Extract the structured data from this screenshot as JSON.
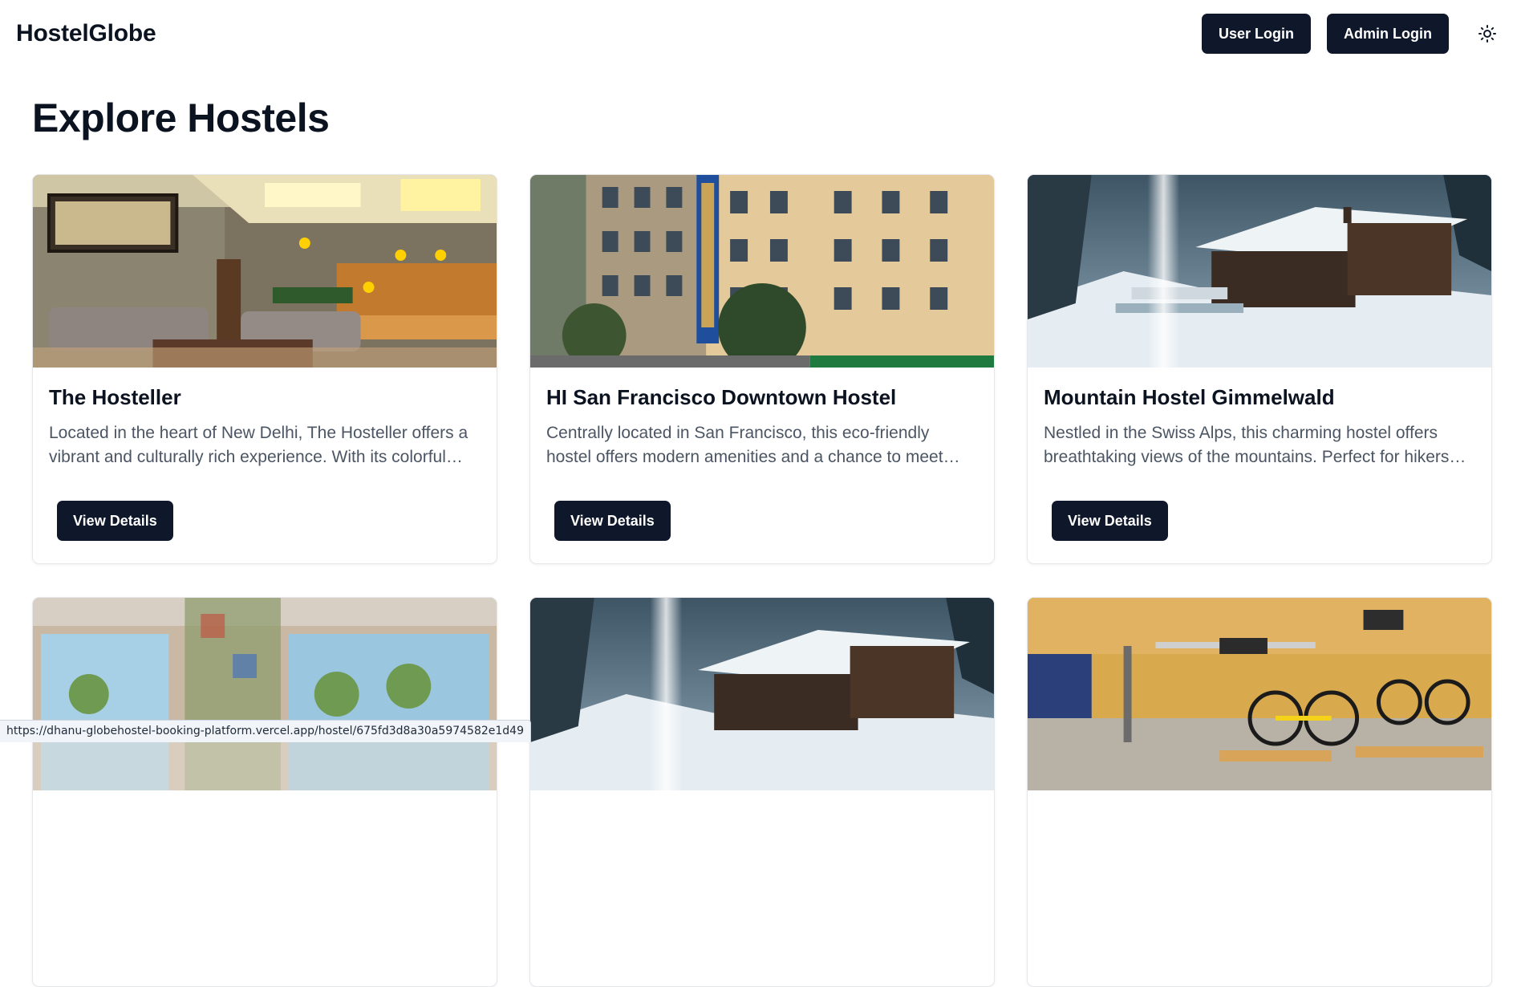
{
  "header": {
    "brand": "HostelGlobe",
    "user_login_label": "User Login",
    "admin_login_label": "Admin Login",
    "theme_toggle_icon": "sun-icon"
  },
  "main": {
    "title": "Explore Hostels",
    "hostels": [
      {
        "name": "The Hosteller",
        "description": "Located in the heart of New Delhi, The Hosteller offers a vibrant and culturally rich experience. With its colorful…",
        "button_label": "View Details",
        "image_icon": "lounge-photo"
      },
      {
        "name": "HI San Francisco Downtown Hostel",
        "description": "Centrally located in San Francisco, this eco-friendly hostel offers modern amenities and a chance to meet…",
        "button_label": "View Details",
        "image_icon": "building-photo"
      },
      {
        "name": "Mountain Hostel Gimmelwald",
        "description": "Nestled in the Swiss Alps, this charming hostel offers breathtaking views of the mountains. Perfect for hikers…",
        "button_label": "View Details",
        "image_icon": "snowy-chalet-photo"
      },
      {
        "name": "",
        "description": "",
        "button_label": "",
        "image_icon": "beach-window-photo"
      },
      {
        "name": "",
        "description": "",
        "button_label": "",
        "image_icon": "snowy-chalet-photo"
      },
      {
        "name": "",
        "description": "",
        "button_label": "",
        "image_icon": "bike-storage-photo"
      }
    ]
  },
  "status_bar": {
    "url": "https://dhanu-globehostel-booking-platform.vercel.app/hostel/675fd3d8a30a5974582e1d49"
  }
}
